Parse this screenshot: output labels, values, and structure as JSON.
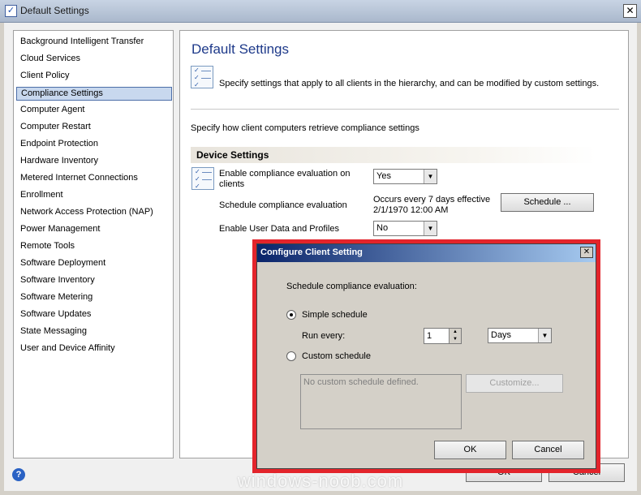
{
  "window": {
    "title": "Default Settings",
    "close": "✕"
  },
  "left_nav": {
    "items": [
      "Background Intelligent Transfer",
      "Cloud Services",
      "Client Policy",
      "Compliance Settings",
      "Computer Agent",
      "Computer Restart",
      "Endpoint Protection",
      "Hardware Inventory",
      "Metered Internet Connections",
      "Enrollment",
      "Network Access Protection (NAP)",
      "Power Management",
      "Remote Tools",
      "Software Deployment",
      "Software Inventory",
      "Software Metering",
      "Software Updates",
      "State Messaging",
      "User and Device Affinity"
    ],
    "selected": "Compliance Settings"
  },
  "main": {
    "heading": "Default Settings",
    "description": "Specify settings that apply to all clients in the hierarchy, and can be modified by custom settings.",
    "specify": "Specify how client computers retrieve compliance settings",
    "group_title": "Device Settings",
    "enable_eval_label": "Enable compliance evaluation on clients",
    "enable_eval_value": "Yes",
    "schedule_label": "Schedule compliance evaluation",
    "schedule_value": "Occurs every 7 days effective 2/1/1970 12:00 AM",
    "schedule_button": "Schedule ...",
    "user_data_label": "Enable User Data and Profiles",
    "user_data_value": "No"
  },
  "footer": {
    "ok": "OK",
    "cancel": "Cancel",
    "help_icon": "?"
  },
  "dialog": {
    "title": "Configure Client Setting",
    "close": "✕",
    "schedule_label": "Schedule compliance evaluation:",
    "simple_schedule": "Simple schedule",
    "run_every": "Run every:",
    "run_every_value": "1",
    "unit": "Days",
    "custom_schedule": "Custom schedule",
    "no_custom": "No custom schedule defined.",
    "customize": "Customize...",
    "ok": "OK",
    "cancel": "Cancel"
  },
  "watermark": "windows-noob.com",
  "colors": {
    "selection": "#c8d8ee",
    "heading": "#1e3a8a",
    "highlight_frame": "#e3242b",
    "dialog_title": "#0a246a"
  }
}
